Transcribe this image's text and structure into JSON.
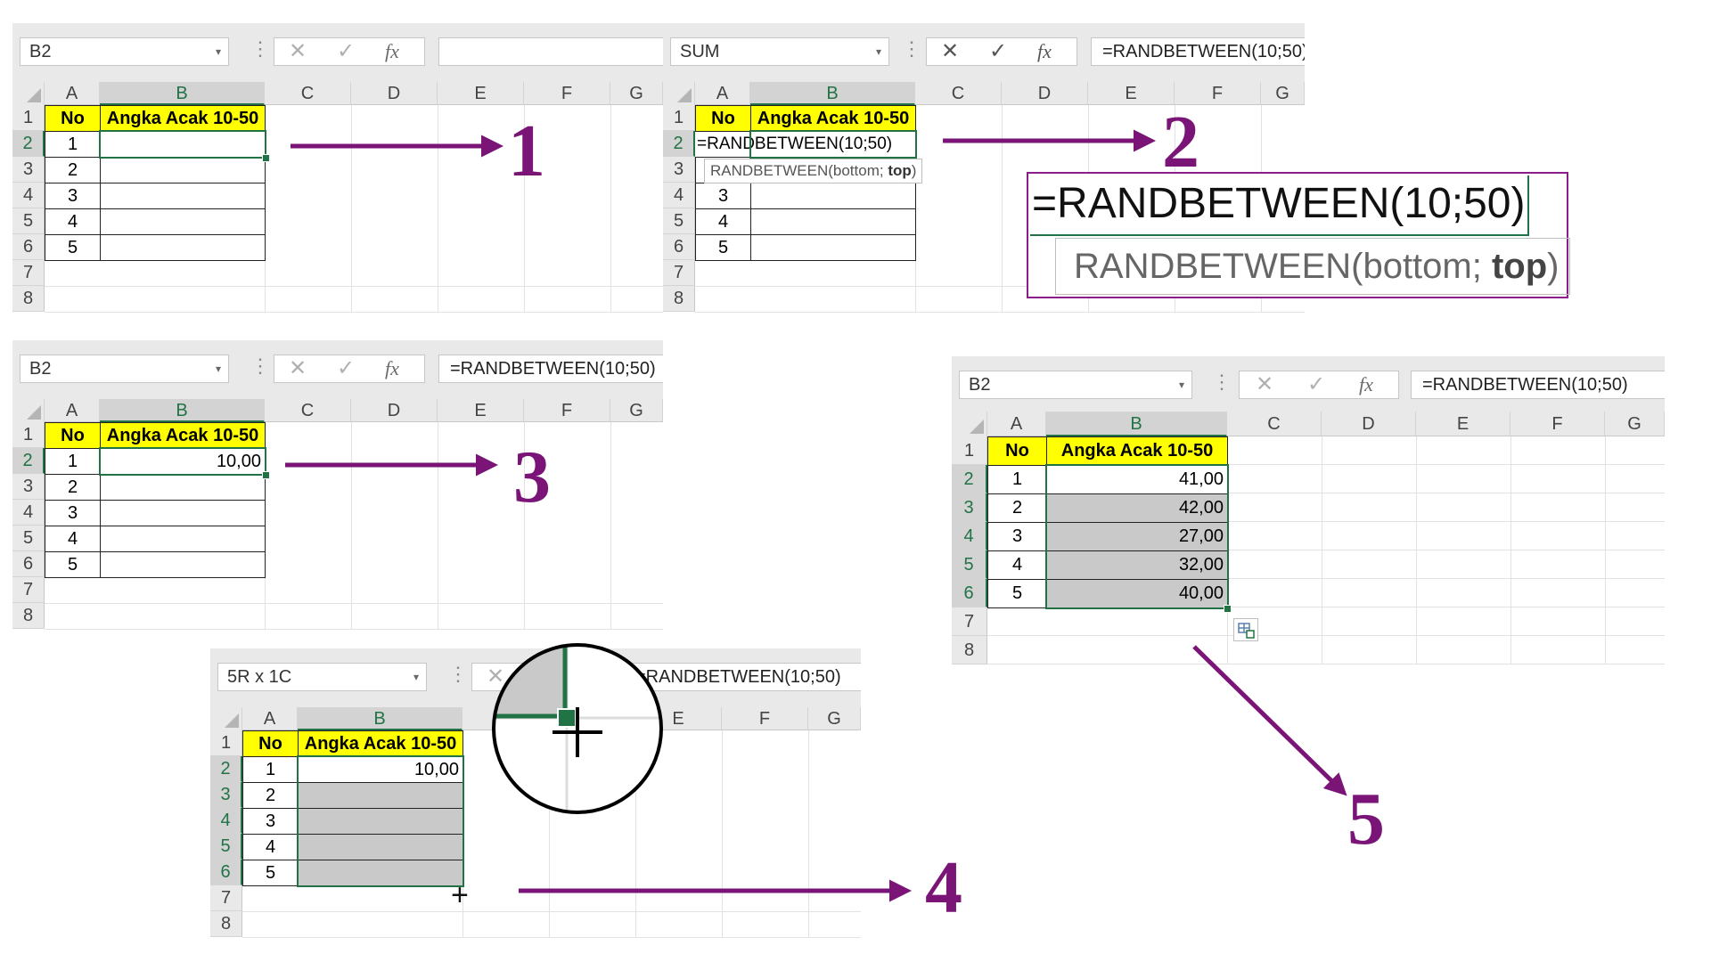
{
  "colors": {
    "arrow": "#7a1476",
    "accent": "#217346",
    "header_fill": "#ffff00",
    "selected_fill": "#c9c9c9"
  },
  "col_headers": [
    "A",
    "B",
    "C",
    "D",
    "E",
    "F",
    "G"
  ],
  "row_headers": [
    "1",
    "2",
    "3",
    "4",
    "5",
    "6",
    "7",
    "8"
  ],
  "table": {
    "col_a_header": "No",
    "col_b_header": "Angka Acak 10-50",
    "numbers": [
      "1",
      "2",
      "3",
      "4",
      "5"
    ]
  },
  "icons": {
    "cancel": "cancel-x-icon",
    "enter": "check-icon",
    "function": "fx-icon",
    "dropdown": "chevron-down-icon"
  },
  "fx_label": "fx",
  "dots": "⋮",
  "dropdown": "▾",
  "step1": {
    "namebox": "B2",
    "formula": "",
    "label": "1"
  },
  "step2": {
    "namebox": "SUM",
    "formula": "=RANDBETWEEN(10;50)",
    "cell_text": "=RANDBETWEEN(10;50)",
    "tooltip_fn": "RANDBETWEEN(bottom; ",
    "tooltip_arg": "top",
    "tooltip_end": ")",
    "label": "2",
    "zoom_formula": "=RANDBETWEEN(10;50)",
    "zoom_tip_fn": "RANDBETWEEN(bottom; ",
    "zoom_tip_arg": "top",
    "zoom_tip_end": ")"
  },
  "step3": {
    "namebox": "B2",
    "formula": "=RANDBETWEEN(10;50)",
    "b2_value": "10,00",
    "label": "3"
  },
  "step4": {
    "namebox": "5R x 1C",
    "formula": "=RANDBETWEEN(10;50)",
    "b2_value": "10,00",
    "label": "4"
  },
  "step5": {
    "namebox": "B2",
    "formula": "=RANDBETWEEN(10;50)",
    "values": [
      "41,00",
      "42,00",
      "27,00",
      "32,00",
      "40,00"
    ],
    "label": "5"
  }
}
